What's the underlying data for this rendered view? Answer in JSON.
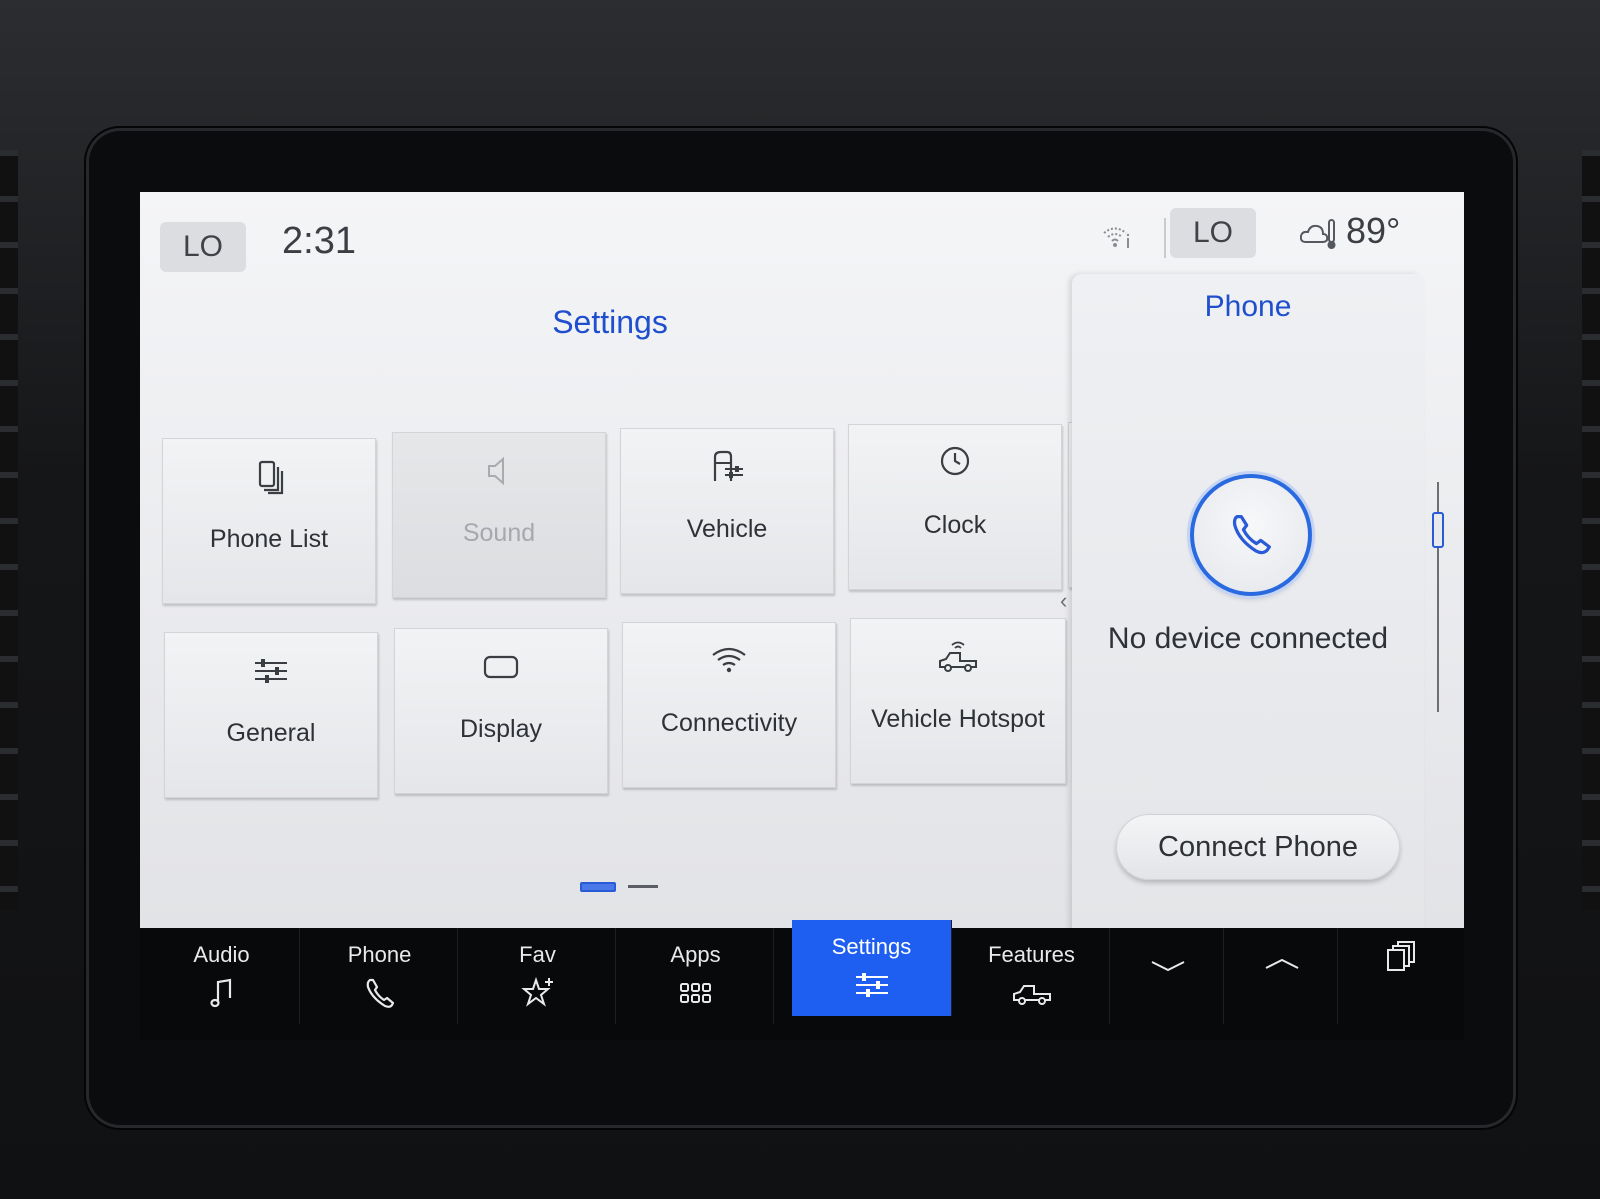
{
  "status_bar": {
    "climate_left": "LO",
    "time": "2:31",
    "climate_right": "LO",
    "temperature": "89°"
  },
  "settings": {
    "title": "Settings",
    "tiles": [
      {
        "label": "Phone List",
        "icon": "phone-list-icon",
        "enabled": true
      },
      {
        "label": "Sound",
        "icon": "speaker-icon",
        "enabled": false
      },
      {
        "label": "Vehicle",
        "icon": "vehicle-settings-icon",
        "enabled": true
      },
      {
        "label": "Clock",
        "icon": "clock-icon",
        "enabled": true
      },
      {
        "label": "General",
        "icon": "sliders-icon",
        "enabled": true
      },
      {
        "label": "Display",
        "icon": "display-icon",
        "enabled": true
      },
      {
        "label": "Connectivity",
        "icon": "wifi-icon",
        "enabled": true
      },
      {
        "label": "Vehicle Hotspot",
        "icon": "truck-hotspot-icon",
        "enabled": true
      }
    ]
  },
  "phone_panel": {
    "title": "Phone",
    "status": "No device connected",
    "connect_label": "Connect Phone"
  },
  "dock": {
    "items": [
      {
        "label": "Audio",
        "icon": "music-note-icon"
      },
      {
        "label": "Phone",
        "icon": "phone-icon"
      },
      {
        "label": "Fav",
        "icon": "star-plus-icon"
      },
      {
        "label": "Apps",
        "icon": "apps-grid-icon"
      },
      {
        "label": "Settings",
        "icon": "sliders-icon",
        "active": true
      },
      {
        "label": "Features",
        "icon": "truck-icon"
      }
    ]
  },
  "colors": {
    "accent_blue": "#1f4fcf",
    "active_tab": "#1e5ff2",
    "screen_bg": "#eceef1"
  }
}
